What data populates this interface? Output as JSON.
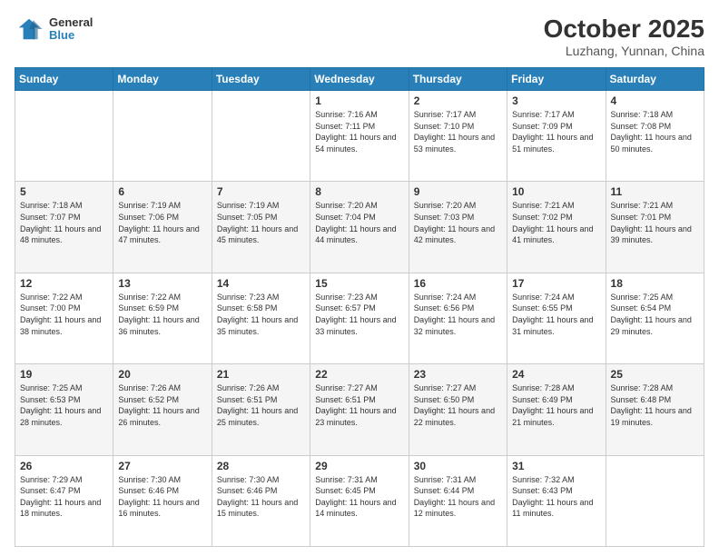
{
  "header": {
    "logo": {
      "line1": "General",
      "line2": "Blue"
    },
    "title": "October 2025",
    "subtitle": "Luzhang, Yunnan, China"
  },
  "days_of_week": [
    "Sunday",
    "Monday",
    "Tuesday",
    "Wednesday",
    "Thursday",
    "Friday",
    "Saturday"
  ],
  "weeks": [
    [
      {
        "day": "",
        "content": ""
      },
      {
        "day": "",
        "content": ""
      },
      {
        "day": "",
        "content": ""
      },
      {
        "day": "1",
        "content": "Sunrise: 7:16 AM\nSunset: 7:11 PM\nDaylight: 11 hours\nand 54 minutes."
      },
      {
        "day": "2",
        "content": "Sunrise: 7:17 AM\nSunset: 7:10 PM\nDaylight: 11 hours\nand 53 minutes."
      },
      {
        "day": "3",
        "content": "Sunrise: 7:17 AM\nSunset: 7:09 PM\nDaylight: 11 hours\nand 51 minutes."
      },
      {
        "day": "4",
        "content": "Sunrise: 7:18 AM\nSunset: 7:08 PM\nDaylight: 11 hours\nand 50 minutes."
      }
    ],
    [
      {
        "day": "5",
        "content": "Sunrise: 7:18 AM\nSunset: 7:07 PM\nDaylight: 11 hours\nand 48 minutes."
      },
      {
        "day": "6",
        "content": "Sunrise: 7:19 AM\nSunset: 7:06 PM\nDaylight: 11 hours\nand 47 minutes."
      },
      {
        "day": "7",
        "content": "Sunrise: 7:19 AM\nSunset: 7:05 PM\nDaylight: 11 hours\nand 45 minutes."
      },
      {
        "day": "8",
        "content": "Sunrise: 7:20 AM\nSunset: 7:04 PM\nDaylight: 11 hours\nand 44 minutes."
      },
      {
        "day": "9",
        "content": "Sunrise: 7:20 AM\nSunset: 7:03 PM\nDaylight: 11 hours\nand 42 minutes."
      },
      {
        "day": "10",
        "content": "Sunrise: 7:21 AM\nSunset: 7:02 PM\nDaylight: 11 hours\nand 41 minutes."
      },
      {
        "day": "11",
        "content": "Sunrise: 7:21 AM\nSunset: 7:01 PM\nDaylight: 11 hours\nand 39 minutes."
      }
    ],
    [
      {
        "day": "12",
        "content": "Sunrise: 7:22 AM\nSunset: 7:00 PM\nDaylight: 11 hours\nand 38 minutes."
      },
      {
        "day": "13",
        "content": "Sunrise: 7:22 AM\nSunset: 6:59 PM\nDaylight: 11 hours\nand 36 minutes."
      },
      {
        "day": "14",
        "content": "Sunrise: 7:23 AM\nSunset: 6:58 PM\nDaylight: 11 hours\nand 35 minutes."
      },
      {
        "day": "15",
        "content": "Sunrise: 7:23 AM\nSunset: 6:57 PM\nDaylight: 11 hours\nand 33 minutes."
      },
      {
        "day": "16",
        "content": "Sunrise: 7:24 AM\nSunset: 6:56 PM\nDaylight: 11 hours\nand 32 minutes."
      },
      {
        "day": "17",
        "content": "Sunrise: 7:24 AM\nSunset: 6:55 PM\nDaylight: 11 hours\nand 31 minutes."
      },
      {
        "day": "18",
        "content": "Sunrise: 7:25 AM\nSunset: 6:54 PM\nDaylight: 11 hours\nand 29 minutes."
      }
    ],
    [
      {
        "day": "19",
        "content": "Sunrise: 7:25 AM\nSunset: 6:53 PM\nDaylight: 11 hours\nand 28 minutes."
      },
      {
        "day": "20",
        "content": "Sunrise: 7:26 AM\nSunset: 6:52 PM\nDaylight: 11 hours\nand 26 minutes."
      },
      {
        "day": "21",
        "content": "Sunrise: 7:26 AM\nSunset: 6:51 PM\nDaylight: 11 hours\nand 25 minutes."
      },
      {
        "day": "22",
        "content": "Sunrise: 7:27 AM\nSunset: 6:51 PM\nDaylight: 11 hours\nand 23 minutes."
      },
      {
        "day": "23",
        "content": "Sunrise: 7:27 AM\nSunset: 6:50 PM\nDaylight: 11 hours\nand 22 minutes."
      },
      {
        "day": "24",
        "content": "Sunrise: 7:28 AM\nSunset: 6:49 PM\nDaylight: 11 hours\nand 21 minutes."
      },
      {
        "day": "25",
        "content": "Sunrise: 7:28 AM\nSunset: 6:48 PM\nDaylight: 11 hours\nand 19 minutes."
      }
    ],
    [
      {
        "day": "26",
        "content": "Sunrise: 7:29 AM\nSunset: 6:47 PM\nDaylight: 11 hours\nand 18 minutes."
      },
      {
        "day": "27",
        "content": "Sunrise: 7:30 AM\nSunset: 6:46 PM\nDaylight: 11 hours\nand 16 minutes."
      },
      {
        "day": "28",
        "content": "Sunrise: 7:30 AM\nSunset: 6:46 PM\nDaylight: 11 hours\nand 15 minutes."
      },
      {
        "day": "29",
        "content": "Sunrise: 7:31 AM\nSunset: 6:45 PM\nDaylight: 11 hours\nand 14 minutes."
      },
      {
        "day": "30",
        "content": "Sunrise: 7:31 AM\nSunset: 6:44 PM\nDaylight: 11 hours\nand 12 minutes."
      },
      {
        "day": "31",
        "content": "Sunrise: 7:32 AM\nSunset: 6:43 PM\nDaylight: 11 hours\nand 11 minutes."
      },
      {
        "day": "",
        "content": ""
      }
    ]
  ]
}
